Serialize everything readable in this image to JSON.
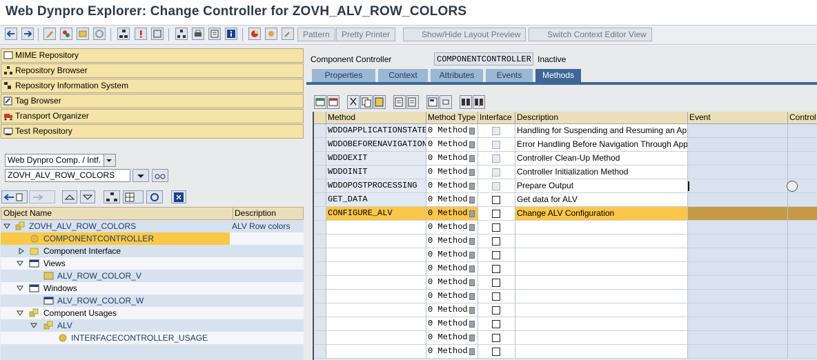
{
  "window": {
    "title": "Web Dynpro Explorer: Change Controller for ZOVH_ALV_ROW_COLORS"
  },
  "toolbar": {
    "buttons": [
      "Pattern",
      "Pretty Printer",
      "Show/Hide Layout Preview",
      "Switch Context Editor View"
    ]
  },
  "left": {
    "nav": [
      "MIME Repository",
      "Repository Browser",
      "Repository Information System",
      "Tag Browser",
      "Transport Organizer",
      "Test Repository"
    ],
    "object_type": "Web Dynpro Comp. / Intf.",
    "object_name": "ZOVH_ALV_ROW_COLORS",
    "tree": {
      "headers": {
        "name": "Object Name",
        "description": "Description"
      },
      "rows": [
        {
          "label": "ZOVH_ALV_ROW_COLORS",
          "desc": "ALV Row colors"
        },
        {
          "label": "COMPONENTCONTROLLER",
          "desc": ""
        },
        {
          "label": "Component Interface",
          "desc": ""
        },
        {
          "label": "Views",
          "desc": ""
        },
        {
          "label": "ALV_ROW_COLOR_V",
          "desc": ""
        },
        {
          "label": "Windows",
          "desc": ""
        },
        {
          "label": "ALV_ROW_COLOR_W",
          "desc": ""
        },
        {
          "label": "Component Usages",
          "desc": ""
        },
        {
          "label": "ALV",
          "desc": ""
        },
        {
          "label": "INTERFACECONTROLLER_USAGE",
          "desc": ""
        }
      ]
    }
  },
  "right": {
    "controller_label": "Component Controller",
    "controller_name": "COMPONENTCONTROLLER",
    "status": "Inactive",
    "tabs": [
      "Properties",
      "Context",
      "Attributes",
      "Events",
      "Methods"
    ],
    "active_tab": "Methods",
    "grid": {
      "headers": {
        "method": "Method",
        "type": "Method Type",
        "interface": "Interface",
        "description": "Description",
        "event": "Event",
        "controller": "Control"
      },
      "rows": [
        {
          "method": "WDDOAPPLICATIONSTATECHANGE",
          "type": "0 Method",
          "description": "Handling for Suspending and Resuming an Application"
        },
        {
          "method": "WDDOBEFORENAVIGATION",
          "type": "0 Method",
          "description": "Error Handling Before Navigation Through Application"
        },
        {
          "method": "WDDOEXIT",
          "type": "0 Method",
          "description": "Controller Clean-Up Method"
        },
        {
          "method": "WDDOINIT",
          "type": "0 Method",
          "description": "Controller Initialization Method"
        },
        {
          "method": "WDDOPOSTPROCESSING",
          "type": "0 Method",
          "description": "Prepare Output"
        },
        {
          "method": "GET_DATA",
          "type": "0 Method",
          "description": "Get data for ALV"
        },
        {
          "method": "CONFIGURE_ALV",
          "type": "0 Method",
          "description": "Change ALV Configuration"
        },
        {
          "method": "",
          "type": "0 Method",
          "description": ""
        },
        {
          "method": "",
          "type": "0 Method",
          "description": ""
        },
        {
          "method": "",
          "type": "0 Method",
          "description": ""
        },
        {
          "method": "",
          "type": "0 Method",
          "description": ""
        },
        {
          "method": "",
          "type": "0 Method",
          "description": ""
        },
        {
          "method": "",
          "type": "0 Method",
          "description": ""
        },
        {
          "method": "",
          "type": "0 Method",
          "description": ""
        },
        {
          "method": "",
          "type": "0 Method",
          "description": ""
        },
        {
          "method": "",
          "type": "0 Method",
          "description": ""
        },
        {
          "method": "",
          "type": "0 Method",
          "description": ""
        }
      ]
    }
  }
}
